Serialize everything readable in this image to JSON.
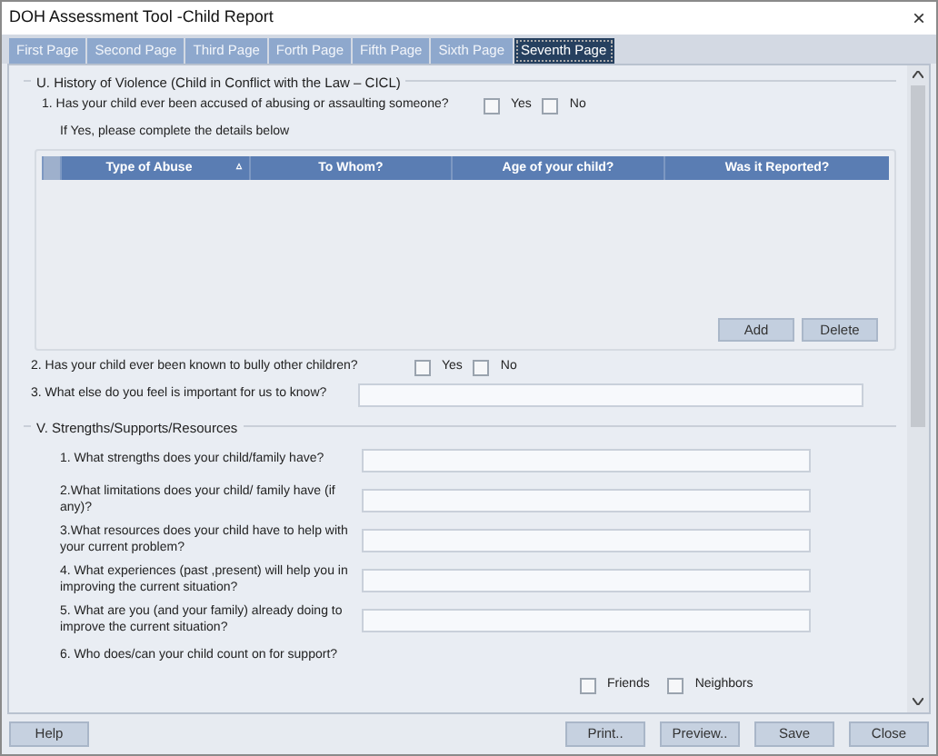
{
  "window": {
    "title": "DOH Assessment Tool -Child Report",
    "close": "×"
  },
  "tabs": [
    {
      "label": "First Page",
      "selected": false
    },
    {
      "label": "Second Page",
      "selected": false
    },
    {
      "label": "Third Page",
      "selected": false
    },
    {
      "label": "Forth Page",
      "selected": false
    },
    {
      "label": "Fifth Page",
      "selected": false
    },
    {
      "label": "Sixth Page",
      "selected": false
    },
    {
      "label": "Seventh Page",
      "selected": true
    }
  ],
  "section_u": {
    "legend": "U. History of Violence (Child in Conflict with the Law – CICL)",
    "question_1": {
      "text": "1. Has your child ever been accused of abusing or assaulting someone?",
      "options": [
        {
          "label": "Yes",
          "checked": false
        },
        {
          "label": "No",
          "checked": false
        }
      ]
    },
    "note": "If Yes, please complete the details below",
    "table": {
      "columns": [
        "Type of Abuse",
        "To Whom?",
        "Age of your child?",
        "Was it Reported?"
      ],
      "sort_mark": "▵"
    },
    "buttons": [
      "Add",
      "Delete"
    ],
    "question_2": {
      "text": "2. Has your child ever been known to bully other children?",
      "options": [
        {
          "label": "Yes",
          "checked": false
        },
        {
          "label": "No",
          "checked": false
        }
      ]
    },
    "question_3": {
      "text": "3.  What else do you feel is important for us to know?"
    }
  },
  "section_v": {
    "legend": "V. Strengths/Supports/Resources",
    "questions": [
      "1. What strengths does your child/family have?",
      "2.What limitations does your child/ family have (if any)?",
      "3.What resources does your child have to help with your current problem?",
      "4. What experiences (past ,present) will help you in improving the current situation?",
      "5. What are you (and your family) already doing to improve the current situation?"
    ],
    "question_6": {
      "text": "6. Who does/can your child count on for  support?",
      "options": [
        {
          "label": "Friends",
          "checked": false
        },
        {
          "label": "Neighbors",
          "checked": false
        }
      ]
    }
  },
  "footer": {
    "left": [
      "Help"
    ],
    "right": [
      "Print..",
      "Preview..",
      "Save",
      "Close"
    ]
  }
}
